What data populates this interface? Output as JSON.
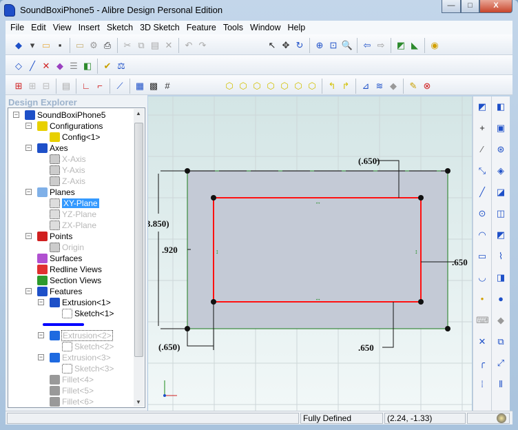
{
  "window": {
    "title": "SoundBoxiPhone5 - Alibre Design Personal Edition",
    "minimize": "—",
    "maximize": "□",
    "close": "X"
  },
  "menu": [
    "File",
    "Edit",
    "View",
    "Insert",
    "Sketch",
    "3D Sketch",
    "Feature",
    "Tools",
    "Window",
    "Help"
  ],
  "toolbars": {
    "row1a": [
      [
        "new-part-icon",
        "#1e50c8",
        "◆"
      ],
      [
        "dropdown-arrow-icon",
        "#444",
        "▾"
      ],
      [
        "open-folder-icon",
        "#e8b04a",
        "▭"
      ],
      [
        "save-icon",
        "#333",
        "▪"
      ],
      "|",
      [
        "open-folder-disabled-icon",
        "#c8b27a",
        "▭"
      ],
      [
        "properties-icon",
        "#999",
        "⚙"
      ],
      [
        "print-icon",
        "#222",
        "⎙"
      ],
      "|",
      [
        "cut-icon",
        "#aaa",
        "✂"
      ],
      [
        "copy-icon",
        "#aaa",
        "⧉"
      ],
      [
        "paste-icon",
        "#aaa",
        "▤"
      ],
      [
        "delete-icon",
        "#aaa",
        "✕"
      ],
      "|",
      [
        "undo-icon",
        "#aaa",
        "↶"
      ],
      [
        "redo-icon",
        "#aaa",
        "↷"
      ]
    ],
    "row1b": [
      [
        "select-arrow-icon",
        "#222",
        "↖"
      ],
      [
        "pan-icon",
        "#333",
        "✥"
      ],
      [
        "rotate-icon",
        "#1e50c8",
        "↻"
      ],
      "|",
      [
        "zoom-in-icon",
        "#1e50c8",
        "⊕"
      ],
      [
        "zoom-window-icon",
        "#1e50c8",
        "⊡"
      ],
      [
        "zoom-fit-icon",
        "#1e50c8",
        "🔍"
      ],
      "|",
      [
        "back-arrow-icon",
        "#1e50c8",
        "⇦"
      ],
      [
        "forward-arrow-icon",
        "#999",
        "⇨"
      ],
      "|",
      [
        "sketch-plane-icon",
        "#2d8a2d",
        "◩"
      ],
      [
        "normal-view-icon",
        "#2d8a2d",
        "◣"
      ],
      "|",
      [
        "render-icon",
        "#d2a000",
        "◉"
      ]
    ],
    "row2": [
      [
        "plane-icon",
        "#1e50c8",
        "◇"
      ],
      [
        "axis-icon",
        "#1e50c8",
        "╱"
      ],
      [
        "point-icon",
        "#d02020",
        "✕"
      ],
      [
        "surface-icon",
        "#9a40c0",
        "◆"
      ],
      [
        "list-icon",
        "#888",
        "☰"
      ],
      [
        "section-view-icon",
        "#2d8a2d",
        "◧"
      ],
      "|",
      [
        "check-icon",
        "#c8a000",
        "✔"
      ],
      [
        "balance-icon",
        "#1e50c8",
        "⚖"
      ]
    ],
    "row3a": [
      [
        "constraint-icon",
        "#d02020",
        "⊞"
      ],
      [
        "constraint-disabled-icon",
        "#bbb",
        "⊞"
      ],
      [
        "constraint2-disabled-icon",
        "#bbb",
        "⊟"
      ],
      "|",
      [
        "clipboard-icon",
        "#aaa",
        "▤"
      ],
      "|",
      [
        "sketch-l-icon",
        "#d02020",
        "∟"
      ],
      [
        "sketch-corner-icon",
        "#d02020",
        "⌐"
      ],
      "|",
      [
        "dimension-toggle-icon",
        "#1e50c8",
        "⟋"
      ],
      "|",
      [
        "grid-snap-icon",
        "#1e50c8",
        "▦"
      ],
      [
        "grid-select-icon",
        "#333",
        "▩"
      ],
      [
        "grid-icon",
        "#333",
        "#"
      ]
    ],
    "row3b": [
      [
        "view-iso-icon",
        "#d2c000",
        "⬡"
      ],
      [
        "view-front-icon",
        "#d2c000",
        "⬡"
      ],
      [
        "view-back-icon",
        "#d2c000",
        "⬡"
      ],
      [
        "view-left-icon",
        "#d2c000",
        "⬡"
      ],
      [
        "view-right-icon",
        "#d2c000",
        "⬡"
      ],
      [
        "view-top-icon",
        "#d2c000",
        "⬡"
      ],
      [
        "view-bottom-icon",
        "#d2c000",
        "⬡"
      ],
      "|",
      [
        "turn-left-icon",
        "#d2c000",
        "↰"
      ],
      [
        "turn-right-icon",
        "#d2c000",
        "↱"
      ],
      "|",
      [
        "measure-icon",
        "#1e50c8",
        "⊿"
      ],
      [
        "section-icon",
        "#1e50c8",
        "≋"
      ],
      [
        "section-disabled-icon",
        "#999",
        "◆"
      ],
      "|",
      [
        "wand-icon",
        "#c8a000",
        "✎"
      ],
      [
        "origin-icon",
        "#d02020",
        "⊗"
      ]
    ]
  },
  "explorer": {
    "title": "Design Explorer",
    "items": [
      {
        "label": "SoundBoxiPhone5",
        "level": 0,
        "exp": true,
        "icon": "part-icon",
        "color": "#1e50c8",
        "state": "normal"
      },
      {
        "label": "Configurations",
        "level": 1,
        "exp": true,
        "icon": "configurations-icon",
        "color": "#e8d000",
        "state": "normal"
      },
      {
        "label": "Config<1>",
        "level": 2,
        "exp": false,
        "icon": "config-icon",
        "color": "#e8d000",
        "state": "normal"
      },
      {
        "label": "Axes",
        "level": 1,
        "exp": true,
        "icon": "axes-icon",
        "color": "#1e50c8",
        "state": "normal"
      },
      {
        "label": "X-Axis",
        "level": 2,
        "exp": false,
        "icon": "axis-icon",
        "color": "#ccc",
        "state": "dim"
      },
      {
        "label": "Y-Axis",
        "level": 2,
        "exp": false,
        "icon": "axis-icon",
        "color": "#ccc",
        "state": "dim"
      },
      {
        "label": "Z-Axis",
        "level": 2,
        "exp": false,
        "icon": "axis-icon",
        "color": "#ccc",
        "state": "dim"
      },
      {
        "label": "Planes",
        "level": 1,
        "exp": true,
        "icon": "planes-icon",
        "color": "#7fb0e8",
        "state": "normal"
      },
      {
        "label": "XY-Plane",
        "level": 2,
        "exp": false,
        "icon": "plane-icon",
        "color": "#ddd",
        "state": "sel"
      },
      {
        "label": "YZ-Plane",
        "level": 2,
        "exp": false,
        "icon": "plane-icon",
        "color": "#ddd",
        "state": "dim"
      },
      {
        "label": "ZX-Plane",
        "level": 2,
        "exp": false,
        "icon": "plane-icon",
        "color": "#ddd",
        "state": "dim"
      },
      {
        "label": "Points",
        "level": 1,
        "exp": true,
        "icon": "points-icon",
        "color": "#d02020",
        "state": "normal"
      },
      {
        "label": "Origin",
        "level": 2,
        "exp": false,
        "icon": "origin-icon",
        "color": "#ccc",
        "state": "dim"
      },
      {
        "label": "Surfaces",
        "level": 1,
        "exp": false,
        "icon": "surfaces-icon",
        "color": "#b050d0",
        "state": "normal"
      },
      {
        "label": "Redline Views",
        "level": 1,
        "exp": false,
        "icon": "redline-views-icon",
        "color": "#e03030",
        "state": "normal"
      },
      {
        "label": "Section Views",
        "level": 1,
        "exp": false,
        "icon": "section-views-icon",
        "color": "#2d9a2d",
        "state": "normal"
      },
      {
        "label": "Features",
        "level": 1,
        "exp": true,
        "icon": "features-icon",
        "color": "#1e50c8",
        "state": "normal"
      },
      {
        "label": "Extrusion<1>",
        "level": 2,
        "exp": true,
        "icon": "extrusion-icon",
        "color": "#1e50c8",
        "state": "normal"
      },
      {
        "label": "Sketch<1>",
        "level": 3,
        "exp": false,
        "icon": "sketch-icon",
        "color": "#fff",
        "state": "normal"
      },
      {
        "label": "",
        "level": 2,
        "exp": false,
        "icon": "rollback-bar-icon",
        "color": "#0000ff",
        "state": "bar"
      },
      {
        "label": "Extrusion<2>",
        "level": 2,
        "exp": true,
        "icon": "extrusion-icon",
        "color": "#1e6ae0",
        "state": "focusdim"
      },
      {
        "label": "Sketch<2>",
        "level": 3,
        "exp": false,
        "icon": "sketch-icon",
        "color": "#fff",
        "state": "dim"
      },
      {
        "label": "Extrusion<3>",
        "level": 2,
        "exp": true,
        "icon": "extrusion-icon",
        "color": "#1e6ae0",
        "state": "dim"
      },
      {
        "label": "Sketch<3>",
        "level": 3,
        "exp": false,
        "icon": "sketch-icon",
        "color": "#fff",
        "state": "dim"
      },
      {
        "label": "Fillet<4>",
        "level": 2,
        "exp": false,
        "icon": "fillet-icon",
        "color": "#999",
        "state": "dim"
      },
      {
        "label": "Fillet<5>",
        "level": 2,
        "exp": false,
        "icon": "fillet-icon",
        "color": "#999",
        "state": "dim"
      },
      {
        "label": "Fillet<6>",
        "level": 2,
        "exp": false,
        "icon": "fillet-icon",
        "color": "#999",
        "state": "dim"
      }
    ]
  },
  "canvas": {
    "dimensions": {
      "top": "(.650)",
      "left_outer": "3.850)",
      "left_inner": ".920",
      "right": ".650",
      "bottom_left": "(.650)",
      "bottom_right": ".650"
    },
    "colors": {
      "sketch": "#ff1010",
      "face": "#c4cad6",
      "constraint": "#1a8a1a"
    }
  },
  "right_toolbar_1": [
    [
      "sketch-mode-icon",
      "#1e50c8",
      "◩"
    ],
    [
      "crosshair-icon",
      "#222",
      "+"
    ],
    [
      "line-icon",
      "#555",
      "⁄"
    ],
    [
      "dimension-icon",
      "#1e50c8",
      "⤡"
    ],
    [
      "line2-icon",
      "#1e50c8",
      "╱"
    ],
    [
      "circle-icon",
      "#1e50c8",
      "⊙"
    ],
    [
      "arc-icon",
      "#1e50c8",
      "◠"
    ],
    [
      "rectangle-icon",
      "#1e50c8",
      "▭"
    ],
    [
      "smile-arc-icon",
      "#1e50c8",
      "◡"
    ],
    [
      "point-icon",
      "#d2a000",
      "•"
    ],
    [
      "keyboard-icon",
      "#999",
      "⌨"
    ],
    [
      "trim-icon",
      "#1e50c8",
      "✕"
    ],
    [
      "fillet-sketch-icon",
      "#1e50c8",
      "╭"
    ],
    [
      "pattern-icon",
      "#1e50c8",
      "⁞"
    ]
  ],
  "right_toolbar_2": [
    [
      "extrude-icon",
      "#1e50c8",
      "◧"
    ],
    [
      "boss-icon",
      "#1e50c8",
      "▣"
    ],
    [
      "revolve-icon",
      "#1e50c8",
      "⊛"
    ],
    [
      "loft-icon",
      "#1e50c8",
      "◈"
    ],
    [
      "sweep-icon",
      "#1e50c8",
      "◪"
    ],
    [
      "cut-icon",
      "#1e50c8",
      "◫"
    ],
    [
      "hole-icon",
      "#1e50c8",
      "◩"
    ],
    [
      "thread-icon",
      "#1e50c8",
      "⌇"
    ],
    [
      "shell-icon",
      "#1e50c8",
      "◨"
    ],
    [
      "fillet-icon",
      "#1e50c8",
      "●"
    ],
    [
      "chamfer-icon",
      "#999",
      "◆"
    ],
    [
      "mirror-icon",
      "#1e50c8",
      "⧉"
    ],
    [
      "scale-icon",
      "#1e50c8",
      "⤢"
    ],
    [
      "rib-icon",
      "#1e50c8",
      "⫴"
    ]
  ],
  "status": {
    "message": "Fully Defined",
    "coords": "(2.24, -1.33)",
    "globe": "globe-icon"
  }
}
